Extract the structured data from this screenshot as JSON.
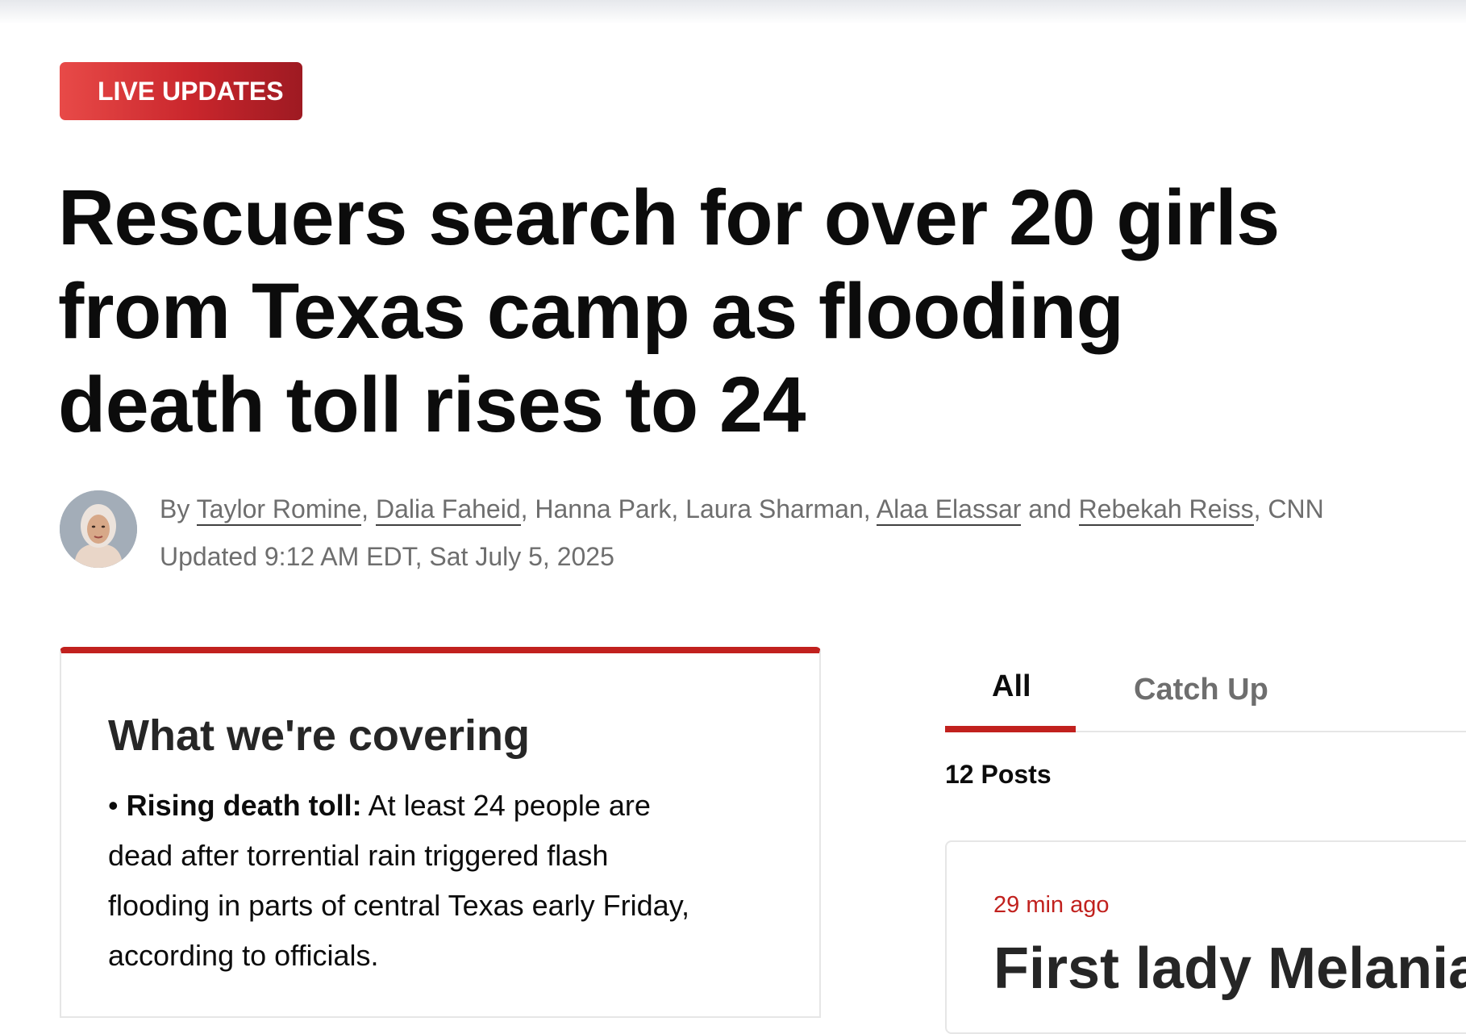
{
  "badge": {
    "label": "LIVE UPDATES"
  },
  "headline": {
    "lines": [
      "Rescuers search for over 20 girls",
      "from Texas camp as flooding",
      "death toll rises to 24"
    ]
  },
  "byline": {
    "prefix": "By",
    "authors": [
      {
        "name": "Taylor Romine",
        "linked": true
      },
      {
        "name": "Dalia Faheid",
        "linked": true
      },
      {
        "name": "Hanna Park",
        "linked": false
      },
      {
        "name": "Laura Sharman",
        "linked": false
      },
      {
        "name": "Alaa Elassar",
        "linked": true
      },
      {
        "name": "Rebekah Reiss",
        "linked": true
      }
    ],
    "conjunction": "and",
    "outlet": "CNN",
    "timestamp": "Updated 9:12 AM EDT, Sat July 5, 2025"
  },
  "covering": {
    "title": "What we're covering",
    "bullet_label": "Rising death toll:",
    "body_lines": [
      "At least 24 people are",
      "dead after torrential rain triggered flash",
      "flooding in parts of central Texas early Friday,",
      "according to officials."
    ]
  },
  "tabs": {
    "all": "All",
    "catch_up": "Catch Up",
    "active": "All"
  },
  "posts": {
    "count_label": "12 Posts",
    "first": {
      "time": "29 min ago",
      "title": "First lady Melania"
    }
  },
  "colors": {
    "accent_red": "#c1211e",
    "text_dark": "#0c0c0c",
    "text_muted": "#6e6e6e",
    "border_light": "#e6e6e6"
  }
}
